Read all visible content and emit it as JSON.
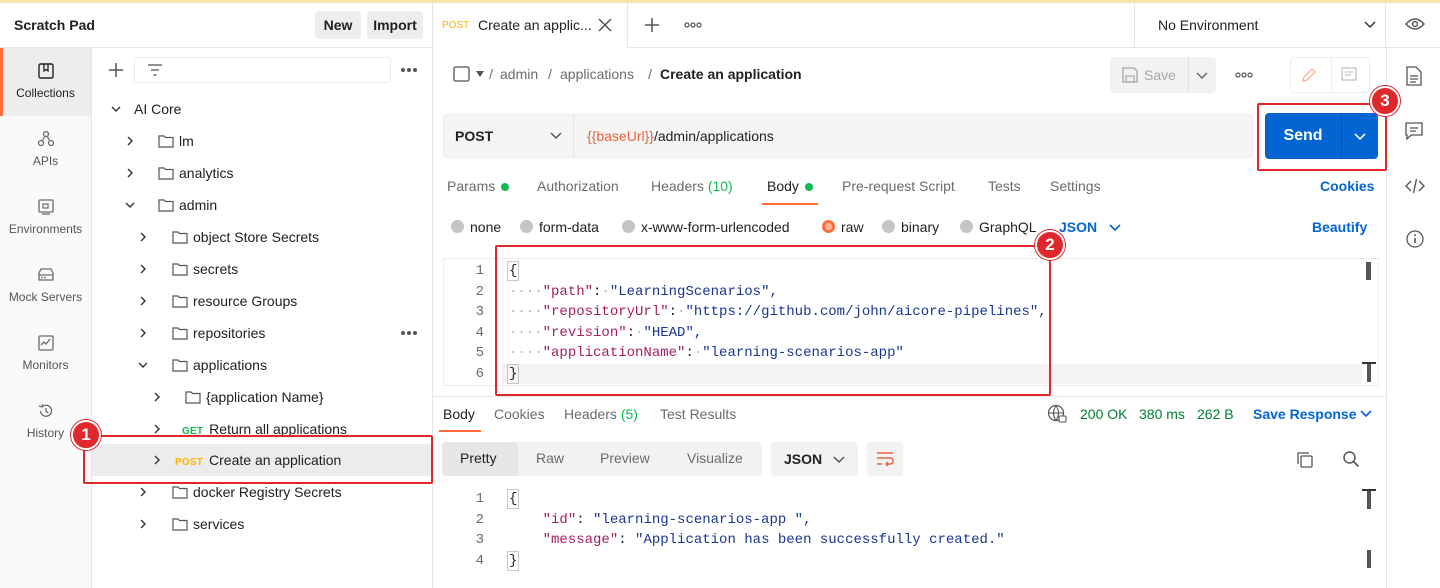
{
  "sidebar": {
    "title": "Scratch Pad",
    "new_label": "New",
    "import_label": "Import",
    "rail": [
      {
        "label": "Collections",
        "icon": "collections-icon"
      },
      {
        "label": "APIs",
        "icon": "apis-icon"
      },
      {
        "label": "Environments",
        "icon": "environments-icon"
      },
      {
        "label": "Mock Servers",
        "icon": "mock-servers-icon"
      },
      {
        "label": "Monitors",
        "icon": "monitors-icon"
      },
      {
        "label": "History",
        "icon": "history-icon"
      }
    ],
    "filter_value": "",
    "tree": [
      {
        "label": "AI Core"
      },
      {
        "label": "lm"
      },
      {
        "label": "analytics"
      },
      {
        "label": "admin"
      },
      {
        "label": "object Store Secrets"
      },
      {
        "label": "secrets"
      },
      {
        "label": "resource Groups"
      },
      {
        "label": "repositories"
      },
      {
        "label": "applications"
      },
      {
        "label": "{application Name}"
      },
      {
        "label": "Return all applications",
        "method": "GET"
      },
      {
        "label": "Create an application",
        "method": "POST"
      },
      {
        "label": "docker Registry Secrets"
      },
      {
        "label": "services"
      }
    ]
  },
  "tabbar": {
    "tab_method": "POST",
    "tab_title": "Create an applic...",
    "environment": "No Environment"
  },
  "breadcrumb": {
    "sep": "/",
    "part1": "admin",
    "part2": "applications",
    "current": "Create an application"
  },
  "toolbar": {
    "save_label": "Save"
  },
  "request": {
    "method": "POST",
    "url_var": "{{baseUrl}}",
    "url_path": "/admin/applications",
    "send_label": "Send"
  },
  "request_tabs": {
    "params": "Params",
    "authorization": "Authorization",
    "headers": "Headers",
    "headers_count": "(10)",
    "body": "Body",
    "prerequest": "Pre-request Script",
    "tests": "Tests",
    "settings": "Settings",
    "cookies": "Cookies"
  },
  "body_types": {
    "none": "none",
    "form_data": "form-data",
    "urlencoded": "x-www-form-urlencoded",
    "raw": "raw",
    "binary": "binary",
    "graphql": "GraphQL",
    "format": "JSON",
    "beautify": "Beautify"
  },
  "request_body": {
    "line_numbers": [
      "1",
      "2",
      "3",
      "4",
      "5",
      "6"
    ],
    "open_brace": "{",
    "close_brace": "}",
    "fields": [
      {
        "key": "\"path\"",
        "value": "\"LearningScenarios\","
      },
      {
        "key": "\"repositoryUrl\"",
        "value": "\"https://github.com/john/aicore-pipelines\","
      },
      {
        "key": "\"revision\"",
        "value": "\"HEAD\","
      },
      {
        "key": "\"applicationName\"",
        "value": "\"learning-scenarios-app\""
      }
    ]
  },
  "response": {
    "tabs": {
      "body": "Body",
      "cookies": "Cookies",
      "headers": "Headers",
      "headers_count": "(5)",
      "test_results": "Test Results"
    },
    "status": "200 OK",
    "time": "380 ms",
    "size": "262 B",
    "save_response": "Save Response",
    "view_tabs": {
      "pretty": "Pretty",
      "raw": "Raw",
      "preview": "Preview",
      "visualize": "Visualize"
    },
    "format": "JSON",
    "line_numbers": [
      "1",
      "2",
      "3",
      "4"
    ],
    "open_brace": "{",
    "close_brace": "}",
    "fields": [
      {
        "key": "\"id\"",
        "value": "\"learning-scenarios-app \","
      },
      {
        "key": "\"message\"",
        "value": "\"Application has been successfully created.\""
      }
    ]
  },
  "annotations": [
    "1",
    "2",
    "3"
  ],
  "colors": {
    "accent": "#ff6c37",
    "send": "#0265d2",
    "annotation": "#e0272c",
    "link_blue": "#0265d2",
    "ok_green": "#007f31"
  }
}
